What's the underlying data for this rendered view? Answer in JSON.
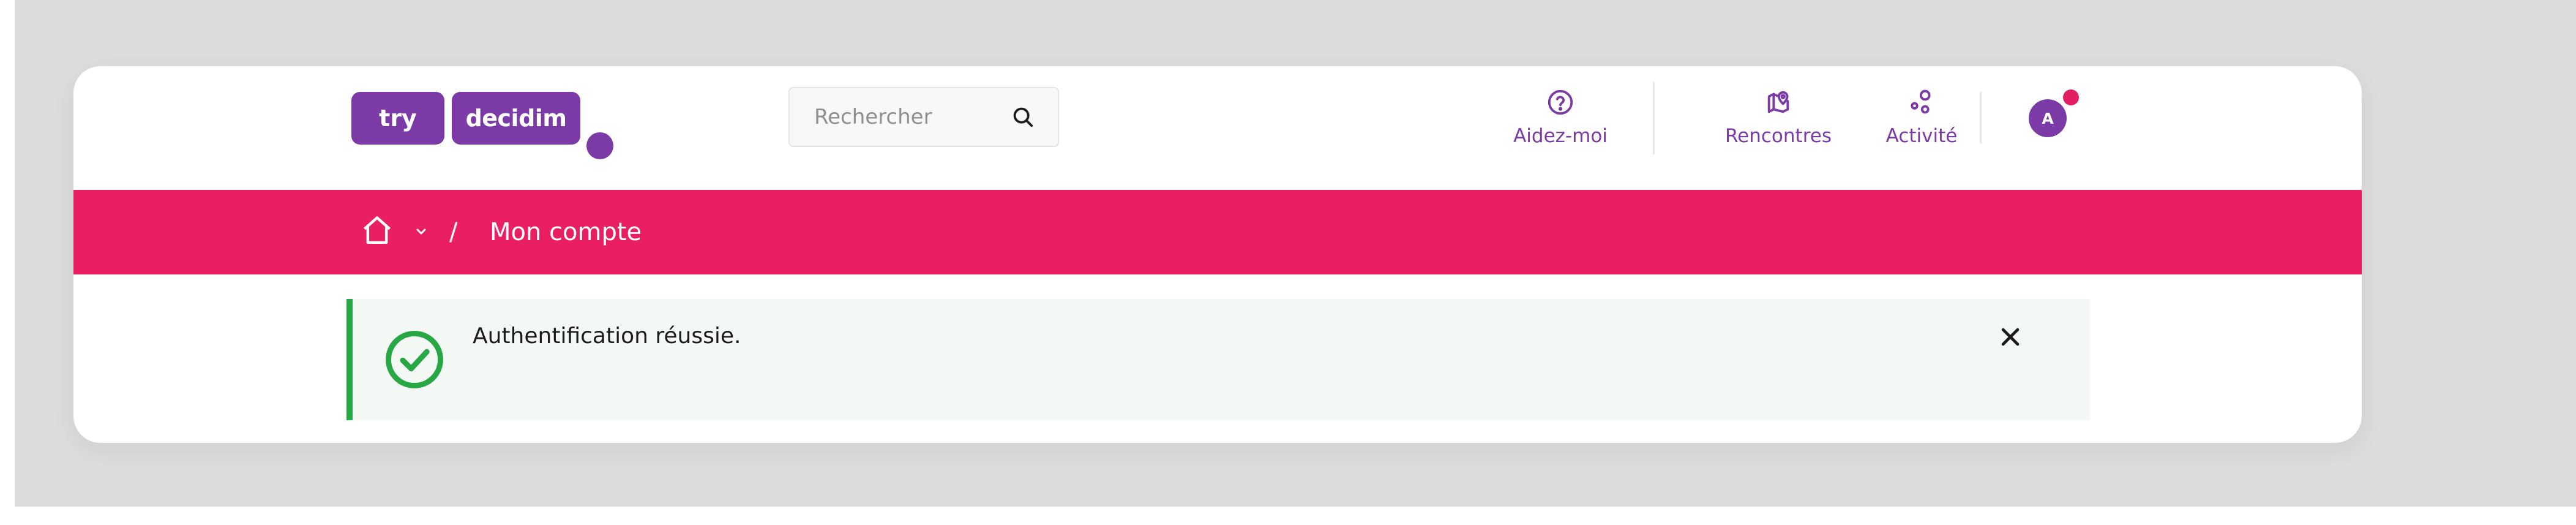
{
  "header": {
    "logo": {
      "primary": "try",
      "secondary": "decidim"
    },
    "search": {
      "placeholder": "Rechercher"
    },
    "nav": [
      {
        "label": "Aidez-moi",
        "icon": "help-circle-icon"
      },
      {
        "label": "Rencontres",
        "icon": "map-pin-icon"
      },
      {
        "label": "Activité",
        "icon": "activity-icon"
      }
    ],
    "user": {
      "initial": "A",
      "has_notification": true
    }
  },
  "breadcrumb": {
    "home_icon": "home-icon",
    "separator": "/",
    "current": "Mon compte"
  },
  "flash": {
    "type": "success",
    "message": "Authentification réussie.",
    "icon": "check-circle-icon",
    "close_icon": "close-icon"
  },
  "colors": {
    "brand_purple": "#7b3aa5",
    "accent_pink": "#e91f62",
    "success_green": "#28a745",
    "flash_bg": "#f3f8f4",
    "page_bg": "#dcdcdc"
  }
}
